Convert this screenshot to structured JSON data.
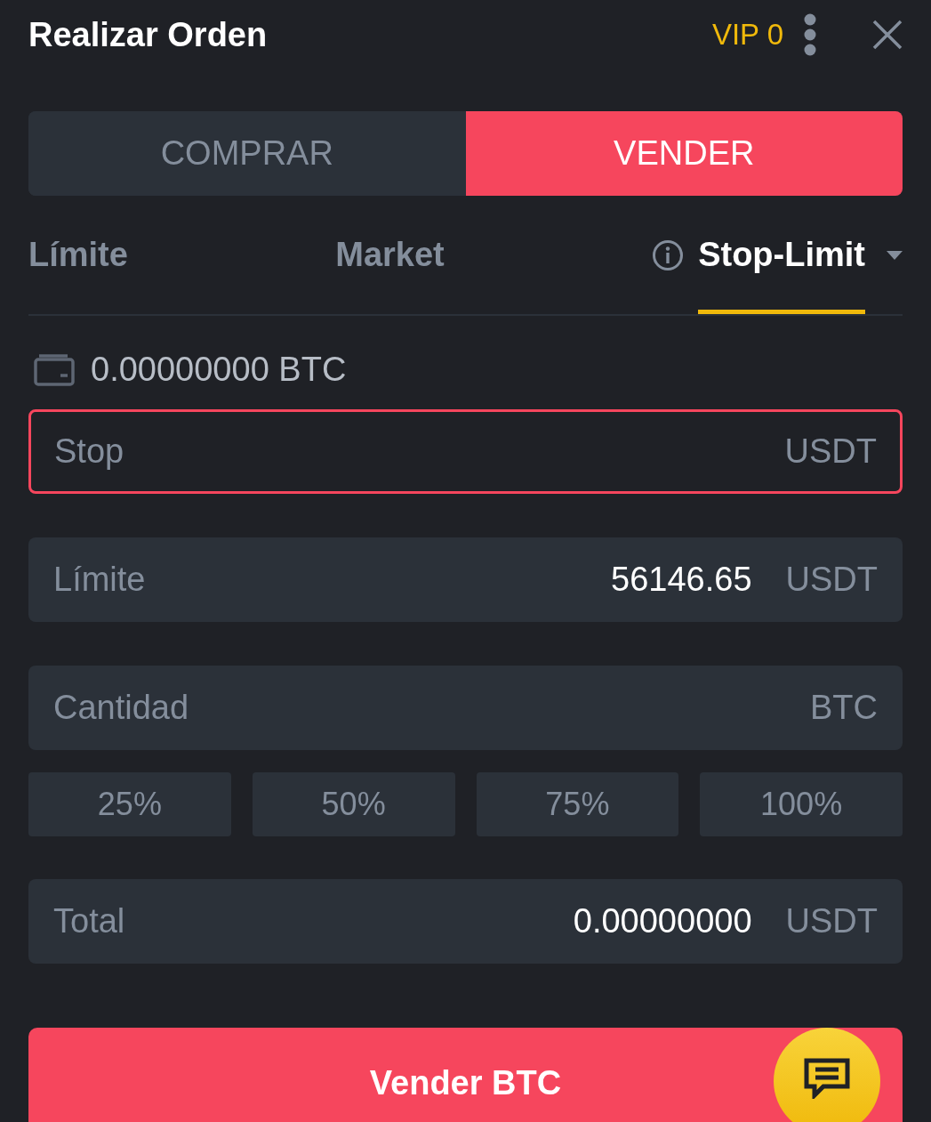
{
  "header": {
    "title": "Realizar Orden",
    "vip": "VIP 0"
  },
  "side_tabs": [
    {
      "label": "COMPRAR",
      "selected": false,
      "kind": "buy"
    },
    {
      "label": "VENDER",
      "selected": true,
      "kind": "sell"
    }
  ],
  "order_types": [
    {
      "label": "Límite",
      "selected": false,
      "kind": "plain"
    },
    {
      "label": "Market",
      "selected": false,
      "kind": "plain"
    },
    {
      "label": "Stop-Limit",
      "selected": true,
      "kind": "dropdown"
    }
  ],
  "balance": "0.00000000 BTC",
  "fields": [
    {
      "label": "Stop",
      "unit": "USDT",
      "focused": true
    },
    {
      "label": "Límite",
      "value": "56146.65",
      "unit": "USDT",
      "focused": false
    },
    {
      "label": "Cantidad",
      "unit": "BTC",
      "focused": false
    }
  ],
  "percent_buttons": [
    "25%",
    "50%",
    "75%",
    "100%"
  ],
  "total": {
    "label": "Total",
    "value": "0.00000000",
    "unit": "USDT"
  },
  "submit": "Vender BTC"
}
